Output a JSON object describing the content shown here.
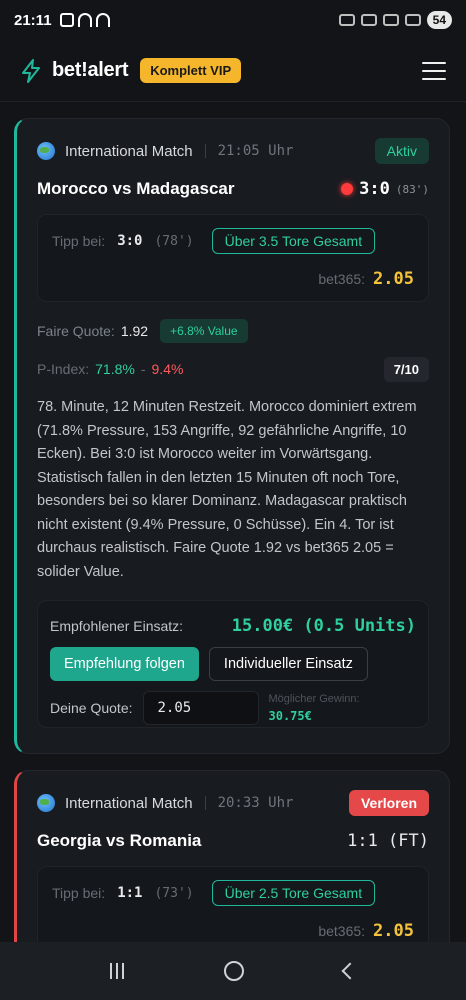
{
  "status_bar": {
    "time": "21:11",
    "battery": "54"
  },
  "header": {
    "brand": "bet!alert",
    "vip_badge": "Komplett VIP",
    "accent": "#1fb89a",
    "vip_color": "#f5b62b"
  },
  "cards": [
    {
      "league": "International Match",
      "kickoff": "21:05 Uhr",
      "status": "Aktiv",
      "match": "Morocco vs Madagascar",
      "score": "3:0",
      "minute": "(83')",
      "tip_label": "Tipp bei:",
      "tip_score": "3:0",
      "tip_minute": "(78')",
      "market": "Über 3.5 Tore Gesamt",
      "bookmaker": "bet365:",
      "odds": "2.05",
      "fair_label": "Faire Quote:",
      "fair_value": "1.92",
      "value_badge": "+6.8% Value",
      "pindex_label": "P-Index:",
      "pindex_home": "71.8%",
      "pindex_sep": "-",
      "pindex_away": "9.4%",
      "rating": "7/10",
      "analysis": "78. Minute, 12 Minuten Restzeit. Morocco dominiert extrem (71.8% Pressure, 153 Angriffe, 92 gefährliche Angriffe, 10 Ecken). Bei 3:0 ist Morocco weiter im Vorwärtsgang. Statistisch fallen in den letzten 15 Minuten oft noch Tore, besonders bei so klarer Dominanz. Madagascar praktisch nicht existent (9.4% Pressure, 0 Schüsse). Ein 4. Tor ist durchaus realistisch. Faire Quote 1.92 vs bet365 2.05 = solider Value.",
      "stake_label": "Empfohlener Einsatz:",
      "stake_value": "15.00€ (0.5 Units)",
      "follow_button": "Empfehlung folgen",
      "custom_button": "Individueller Einsatz",
      "quote_label": "Deine Quote:",
      "quote_value": "2.05",
      "gain_label": "Möglicher Gewinn:",
      "gain_value": "30.75€"
    },
    {
      "league": "International Match",
      "kickoff": "20:33 Uhr",
      "status": "Verloren",
      "match": "Georgia vs Romania",
      "score": "1:1 (FT)",
      "tip_label": "Tipp bei:",
      "tip_score": "1:1",
      "tip_minute": "(73')",
      "market": "Über 2.5 Tore Gesamt",
      "bookmaker": "bet365:",
      "odds": "2.05"
    }
  ]
}
